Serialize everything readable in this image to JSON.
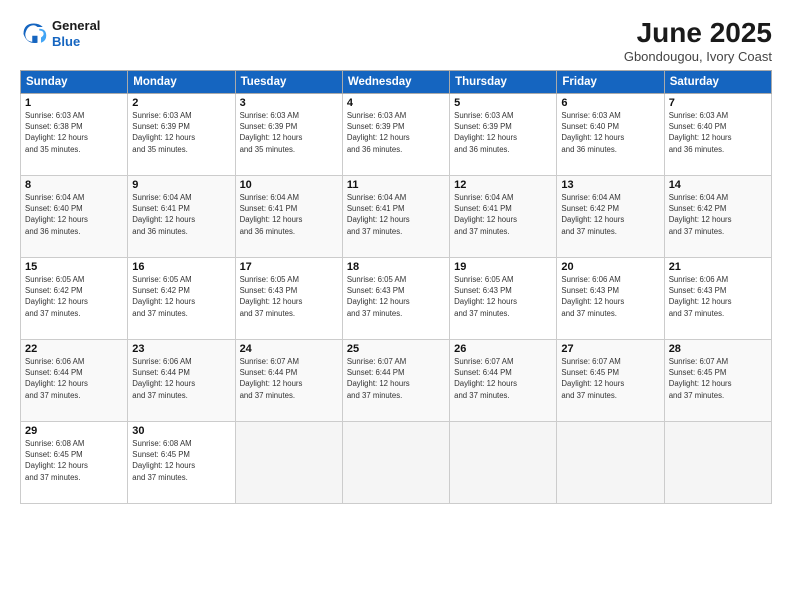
{
  "logo": {
    "line1": "General",
    "line2": "Blue"
  },
  "title": "June 2025",
  "subtitle": "Gbondougou, Ivory Coast",
  "days_of_week": [
    "Sunday",
    "Monday",
    "Tuesday",
    "Wednesday",
    "Thursday",
    "Friday",
    "Saturday"
  ],
  "weeks": [
    [
      {
        "day": "1",
        "info": "Sunrise: 6:03 AM\nSunset: 6:38 PM\nDaylight: 12 hours\nand 35 minutes."
      },
      {
        "day": "2",
        "info": "Sunrise: 6:03 AM\nSunset: 6:39 PM\nDaylight: 12 hours\nand 35 minutes."
      },
      {
        "day": "3",
        "info": "Sunrise: 6:03 AM\nSunset: 6:39 PM\nDaylight: 12 hours\nand 35 minutes."
      },
      {
        "day": "4",
        "info": "Sunrise: 6:03 AM\nSunset: 6:39 PM\nDaylight: 12 hours\nand 36 minutes."
      },
      {
        "day": "5",
        "info": "Sunrise: 6:03 AM\nSunset: 6:39 PM\nDaylight: 12 hours\nand 36 minutes."
      },
      {
        "day": "6",
        "info": "Sunrise: 6:03 AM\nSunset: 6:40 PM\nDaylight: 12 hours\nand 36 minutes."
      },
      {
        "day": "7",
        "info": "Sunrise: 6:03 AM\nSunset: 6:40 PM\nDaylight: 12 hours\nand 36 minutes."
      }
    ],
    [
      {
        "day": "8",
        "info": "Sunrise: 6:04 AM\nSunset: 6:40 PM\nDaylight: 12 hours\nand 36 minutes."
      },
      {
        "day": "9",
        "info": "Sunrise: 6:04 AM\nSunset: 6:41 PM\nDaylight: 12 hours\nand 36 minutes."
      },
      {
        "day": "10",
        "info": "Sunrise: 6:04 AM\nSunset: 6:41 PM\nDaylight: 12 hours\nand 36 minutes."
      },
      {
        "day": "11",
        "info": "Sunrise: 6:04 AM\nSunset: 6:41 PM\nDaylight: 12 hours\nand 37 minutes."
      },
      {
        "day": "12",
        "info": "Sunrise: 6:04 AM\nSunset: 6:41 PM\nDaylight: 12 hours\nand 37 minutes."
      },
      {
        "day": "13",
        "info": "Sunrise: 6:04 AM\nSunset: 6:42 PM\nDaylight: 12 hours\nand 37 minutes."
      },
      {
        "day": "14",
        "info": "Sunrise: 6:04 AM\nSunset: 6:42 PM\nDaylight: 12 hours\nand 37 minutes."
      }
    ],
    [
      {
        "day": "15",
        "info": "Sunrise: 6:05 AM\nSunset: 6:42 PM\nDaylight: 12 hours\nand 37 minutes."
      },
      {
        "day": "16",
        "info": "Sunrise: 6:05 AM\nSunset: 6:42 PM\nDaylight: 12 hours\nand 37 minutes."
      },
      {
        "day": "17",
        "info": "Sunrise: 6:05 AM\nSunset: 6:43 PM\nDaylight: 12 hours\nand 37 minutes."
      },
      {
        "day": "18",
        "info": "Sunrise: 6:05 AM\nSunset: 6:43 PM\nDaylight: 12 hours\nand 37 minutes."
      },
      {
        "day": "19",
        "info": "Sunrise: 6:05 AM\nSunset: 6:43 PM\nDaylight: 12 hours\nand 37 minutes."
      },
      {
        "day": "20",
        "info": "Sunrise: 6:06 AM\nSunset: 6:43 PM\nDaylight: 12 hours\nand 37 minutes."
      },
      {
        "day": "21",
        "info": "Sunrise: 6:06 AM\nSunset: 6:43 PM\nDaylight: 12 hours\nand 37 minutes."
      }
    ],
    [
      {
        "day": "22",
        "info": "Sunrise: 6:06 AM\nSunset: 6:44 PM\nDaylight: 12 hours\nand 37 minutes."
      },
      {
        "day": "23",
        "info": "Sunrise: 6:06 AM\nSunset: 6:44 PM\nDaylight: 12 hours\nand 37 minutes."
      },
      {
        "day": "24",
        "info": "Sunrise: 6:07 AM\nSunset: 6:44 PM\nDaylight: 12 hours\nand 37 minutes."
      },
      {
        "day": "25",
        "info": "Sunrise: 6:07 AM\nSunset: 6:44 PM\nDaylight: 12 hours\nand 37 minutes."
      },
      {
        "day": "26",
        "info": "Sunrise: 6:07 AM\nSunset: 6:44 PM\nDaylight: 12 hours\nand 37 minutes."
      },
      {
        "day": "27",
        "info": "Sunrise: 6:07 AM\nSunset: 6:45 PM\nDaylight: 12 hours\nand 37 minutes."
      },
      {
        "day": "28",
        "info": "Sunrise: 6:07 AM\nSunset: 6:45 PM\nDaylight: 12 hours\nand 37 minutes."
      }
    ],
    [
      {
        "day": "29",
        "info": "Sunrise: 6:08 AM\nSunset: 6:45 PM\nDaylight: 12 hours\nand 37 minutes."
      },
      {
        "day": "30",
        "info": "Sunrise: 6:08 AM\nSunset: 6:45 PM\nDaylight: 12 hours\nand 37 minutes."
      },
      {
        "day": "",
        "info": ""
      },
      {
        "day": "",
        "info": ""
      },
      {
        "day": "",
        "info": ""
      },
      {
        "day": "",
        "info": ""
      },
      {
        "day": "",
        "info": ""
      }
    ]
  ]
}
